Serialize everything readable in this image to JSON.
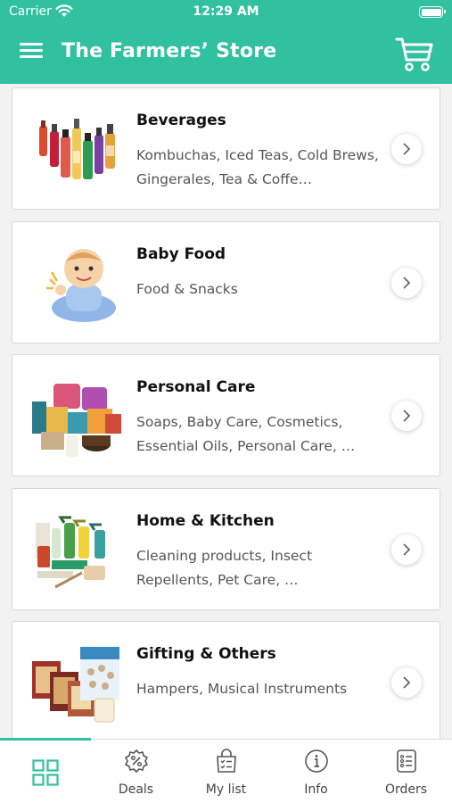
{
  "status_bar": {
    "carrier": "Carrier",
    "time": "12:29 AM"
  },
  "header": {
    "title": "The Farmers’ Store",
    "menu_icon": "hamburger-menu-icon",
    "cart_icon": "shopping-cart-icon",
    "accent_color": "#31c0a0"
  },
  "categories": [
    {
      "title": "Beverages",
      "description": "Kombuchas, Iced Teas, Cold Brews, Gingerales, Tea & Coffe…"
    },
    {
      "title": "Baby Food",
      "description": "Food & Snacks"
    },
    {
      "title": "Personal Care",
      "description": "Soaps, Baby Care, Cosmetics, Essential Oils, Personal Care, …"
    },
    {
      "title": "Home & Kitchen",
      "description": "Cleaning products, Insect Repellents, Pet Care, …"
    },
    {
      "title": "Gifting & Others",
      "description": "Hampers, Musical Instruments"
    }
  ],
  "tabbar": {
    "tabs": [
      {
        "label": "",
        "icon": "grid-icon",
        "active": true
      },
      {
        "label": "Deals",
        "icon": "deals-badge-icon"
      },
      {
        "label": "My list",
        "icon": "shopping-bag-list-icon"
      },
      {
        "label": "Info",
        "icon": "info-icon"
      },
      {
        "label": "Orders",
        "icon": "orders-list-icon"
      }
    ]
  }
}
